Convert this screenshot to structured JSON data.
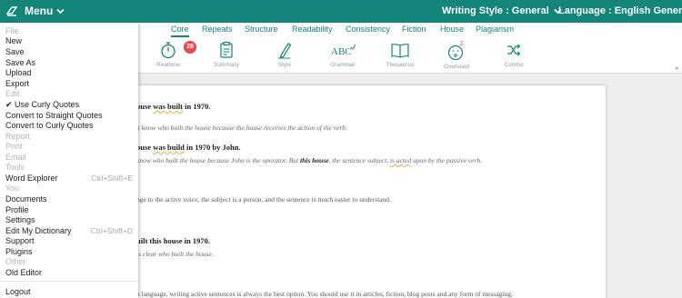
{
  "topbar": {
    "menu_label": "Menu",
    "writing_style": "Writing Style : General",
    "language": "Language : English General"
  },
  "tabs": [
    "Core",
    "Repeats",
    "Structure",
    "Readability",
    "Consistency",
    "Fiction",
    "House",
    "Plagiarism"
  ],
  "tools": {
    "realtime": "Realtime",
    "summary": "Summary",
    "style": "Style",
    "grammar": "Grammar",
    "thesaurus": "Thesaurus",
    "overused": "Overused",
    "combo": "Combo",
    "realtime_badge": "28"
  },
  "menu": {
    "file": "File",
    "new": "New",
    "save": "Save",
    "save_as": "Save As",
    "upload": "Upload",
    "export": "Export",
    "edit": "Edit",
    "use_curly": "✔ Use Curly Quotes",
    "to_straight": "Convert to Straight Quotes",
    "to_curly": "Convert to Curly Quotes",
    "report": "Report",
    "print": "Print",
    "email": "Email",
    "tools": "Tools",
    "word_explorer": "Word Explorer",
    "word_explorer_shortcut": "Ctrl+Shift+E",
    "you": "You",
    "documents": "Documents",
    "profile": "Profile",
    "settings": "Settings",
    "edit_dictionary": "Edit My Dictionary",
    "edit_dictionary_shortcut": "Ctrl+Shift+D",
    "support": "Support",
    "plugins": "Plugins",
    "other": "Other",
    "old_editor": "Old Editor",
    "logout": "Logout"
  },
  "doc": {
    "l1a": "ouse ",
    "l1b": "was built",
    "l1c": " in 1970.",
    "l2": "'t know who built the house because the house receives the action of the verb.",
    "l3a": "ouse ",
    "l3b": "was build",
    "l3c": " in 1970 by John.",
    "l4a": "know who built the house because John is the operator. But ",
    "l4b": "this house",
    "l4c": ", the sentence subject, ",
    "l4d": "is acted",
    "l4e": " upon by the passive verb.",
    "l5": "nge to the active voice, the subject is a person, and the sentence is much easier to understand.",
    "l6": "uilt this house in 1970.",
    "l7": "is clear who built the house.",
    "l8": "h language, writing active sentences is always the best option. You should use it in articles, fiction, blog posts and any form of messaging,"
  },
  "colors": {
    "brand": "#138579",
    "badge": "#e8474c"
  }
}
